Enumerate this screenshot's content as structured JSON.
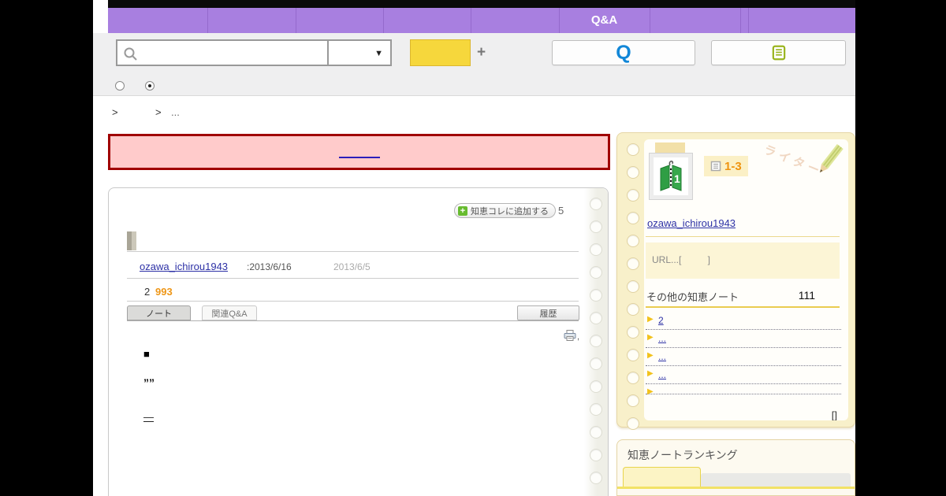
{
  "nav": {
    "qa_label": "Q&A"
  },
  "header": {
    "plus_sign": "+",
    "q_logo": "Q"
  },
  "breadcrumb": {
    "sep1": ">",
    "sep2": ">",
    "dots": "..."
  },
  "card": {
    "add_collection_label": "知恵コレに追加する",
    "add_count": "5",
    "author": "ozawa_ichirou1943",
    "updated": ":2013/6/16",
    "created": "2013/6/5",
    "stat_primary": "2",
    "stat_views": "993",
    "tab_note": "ノート",
    "tab_related": "関連Q&A",
    "history_label": "履歴",
    "printer_suffix": ",",
    "body_square": "■",
    "body_quotes": "””",
    "body_dash": "—"
  },
  "sidebar": {
    "badge": "1-3",
    "writer_deco": "ライター",
    "username": "ozawa_ichirou1943",
    "url_text": "URL...[          ]",
    "other_notes_label": "その他の知恵ノート",
    "other_notes_count": "111",
    "list": [
      {
        "label": "2"
      },
      {
        "label": "..."
      },
      {
        "label": "... "
      },
      {
        "label": "..."
      },
      {
        "label": ""
      }
    ],
    "footer_link": "[]"
  },
  "ranking": {
    "title": "知恵ノートランキング"
  },
  "colors": {
    "nav_purple": "#a87fe0",
    "alert_border": "#a00000",
    "alert_bg": "#ffcbcb",
    "accent_yellow": "#f6d73c",
    "link_blue": "#2d31a6",
    "views_orange": "#ee9617",
    "note_cream": "#f8f0ca",
    "q_logo_blue": "#1287d8",
    "note_icon_green": "#9ab41e"
  }
}
